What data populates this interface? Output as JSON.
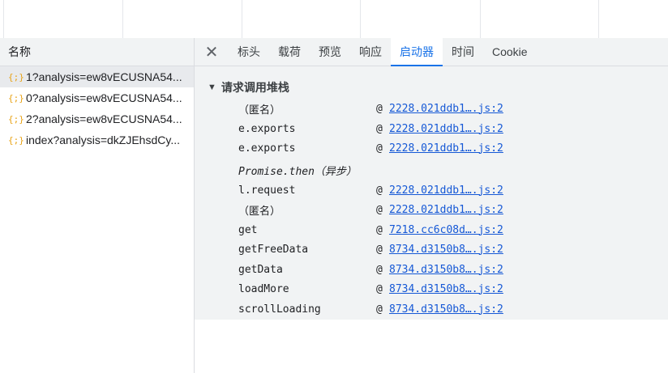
{
  "left_panel": {
    "header": "名称",
    "requests": [
      {
        "icon": "{;}",
        "name": "1?analysis=ew8vECUSNA54...",
        "selected": true
      },
      {
        "icon": "{;}",
        "name": "0?analysis=ew8vECUSNA54...",
        "selected": false
      },
      {
        "icon": "{;}",
        "name": "2?analysis=ew8vECUSNA54...",
        "selected": false
      },
      {
        "icon": "{;}",
        "name": "index?analysis=dkZJEhsdCy...",
        "selected": false
      }
    ]
  },
  "tabs": {
    "close_icon": "✕",
    "items": [
      "标头",
      "载荷",
      "预览",
      "响应",
      "启动器",
      "时间",
      "Cookie"
    ],
    "active": "启动器"
  },
  "stack": {
    "title_toggle": "▼",
    "title": "请求调用堆栈",
    "frames": [
      {
        "fn": "（匿名）",
        "at": "@",
        "loc": "2228.021ddb1….js:2"
      },
      {
        "fn": "e.exports",
        "at": "@",
        "loc": "2228.021ddb1….js:2"
      },
      {
        "fn": "e.exports",
        "at": "@",
        "loc": "2228.021ddb1….js:2"
      },
      {
        "fn": "Promise.then（异步）",
        "at": "",
        "loc": "",
        "async": true
      },
      {
        "fn": "l.request",
        "at": "@",
        "loc": "2228.021ddb1….js:2"
      },
      {
        "fn": "（匿名）",
        "at": "@",
        "loc": "2228.021ddb1….js:2"
      },
      {
        "fn": "get",
        "at": "@",
        "loc": "7218.cc6c08d….js:2"
      },
      {
        "fn": "getFreeData",
        "at": "@",
        "loc": "8734.d3150b8….js:2"
      },
      {
        "fn": "getData",
        "at": "@",
        "loc": "8734.d3150b8….js:2"
      },
      {
        "fn": "loadMore",
        "at": "@",
        "loc": "8734.d3150b8….js:2"
      },
      {
        "fn": "scrollLoading",
        "at": "@",
        "loc": "8734.d3150b8….js:2"
      }
    ]
  }
}
